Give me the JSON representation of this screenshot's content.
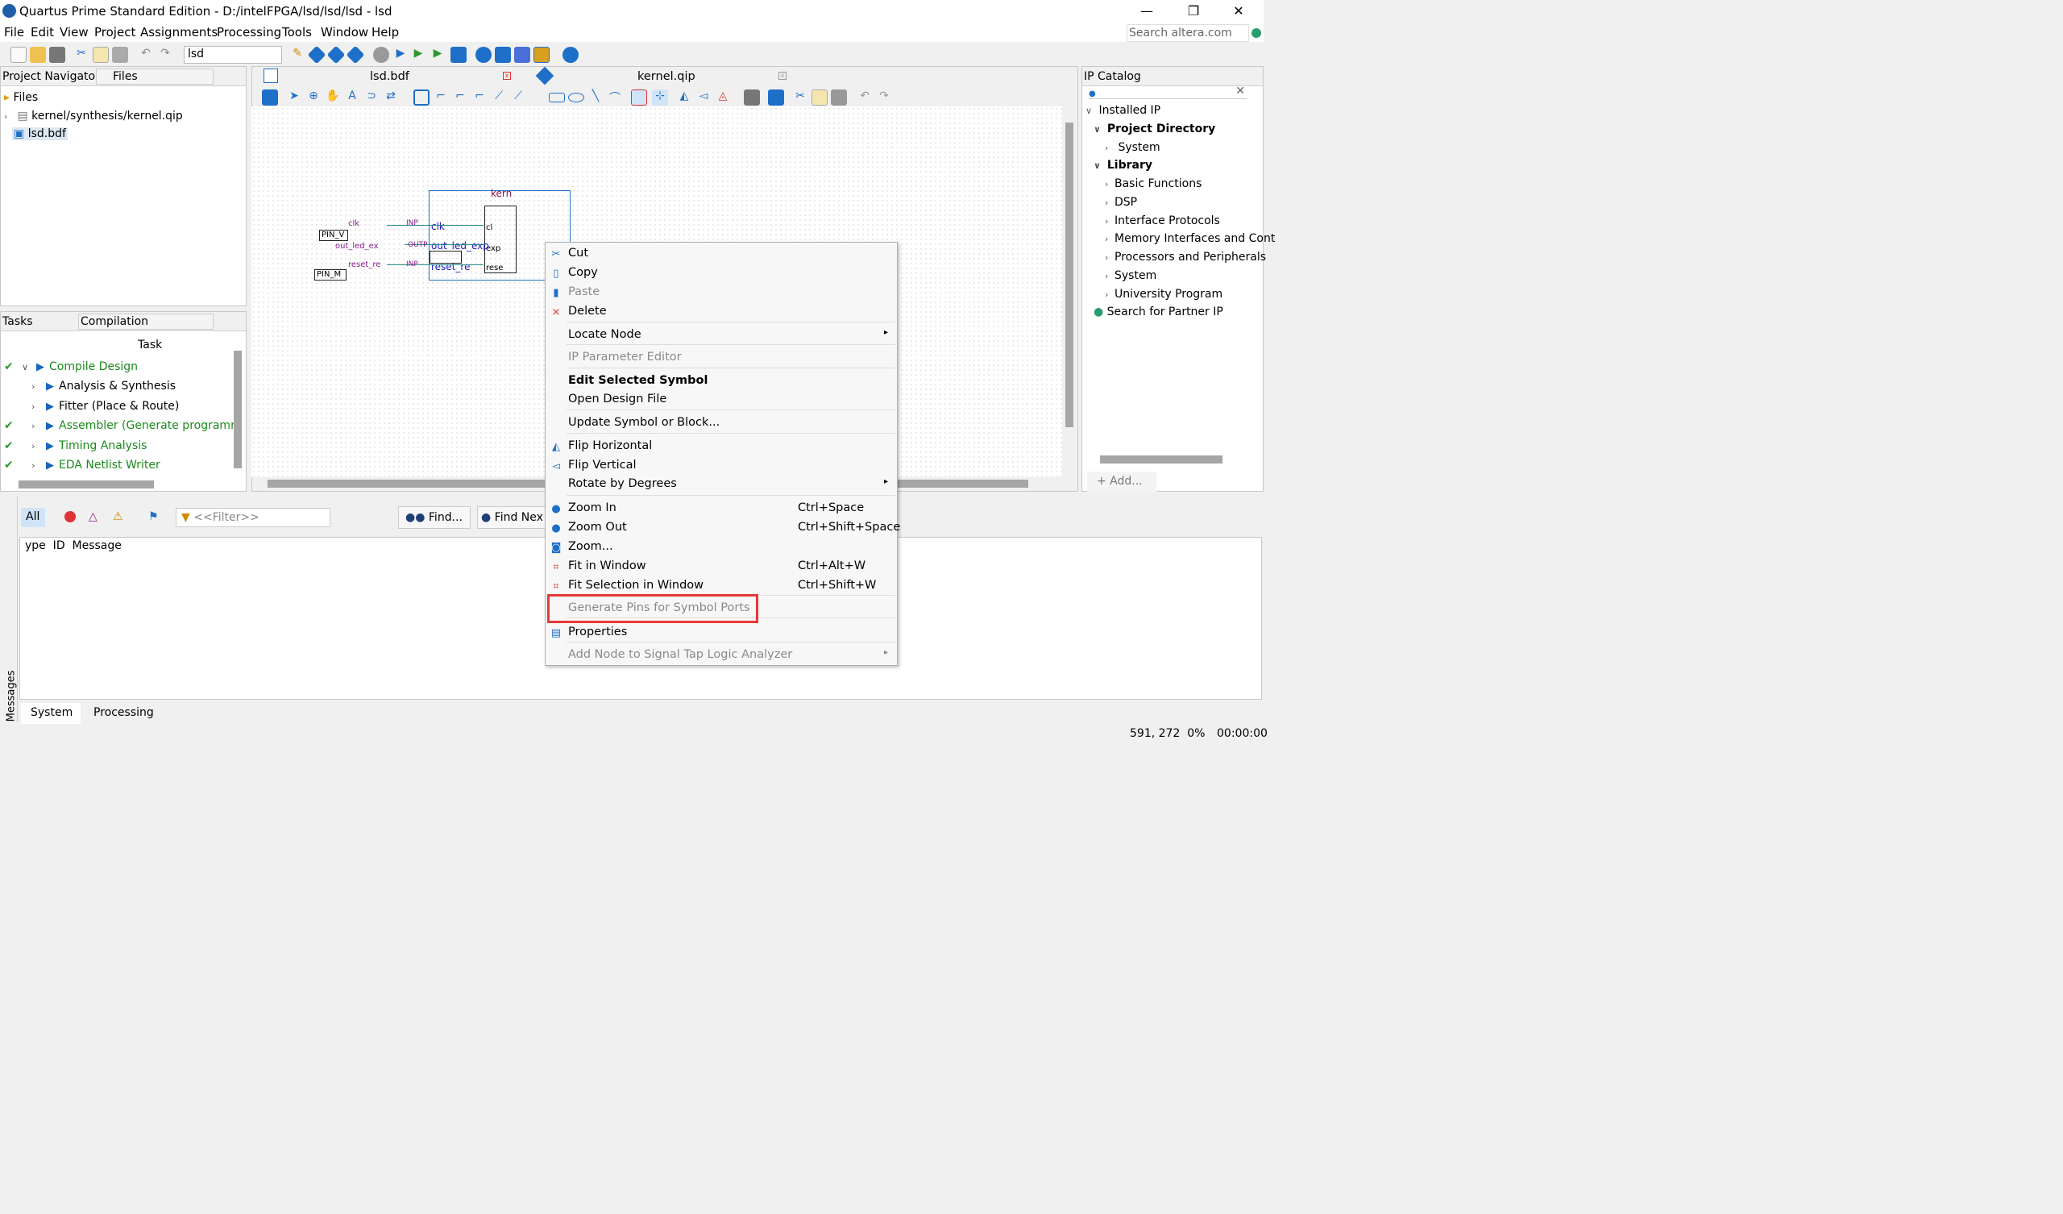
{
  "window": {
    "title": "Quartus Prime Standard Edition - D:/intelFPGA/lsd/lsd/lsd - lsd",
    "minimize": "—",
    "maximize": "❐",
    "close": "✕"
  },
  "menubar": {
    "items": [
      "File",
      "Edit",
      "View",
      "Project",
      "Assignments",
      "Processing",
      "Tools",
      "Window",
      "Help"
    ],
    "search_placeholder": "Search altera.com"
  },
  "toolbar": {
    "revision": "lsd"
  },
  "project_navigator": {
    "title": "Project Navigator",
    "view": "Files",
    "root": "Files",
    "items": [
      "kernel/synthesis/kernel.qip",
      "lsd.bdf"
    ]
  },
  "tasks": {
    "title": "Tasks",
    "flow": "Compilation",
    "column": "Task",
    "rows": [
      {
        "label": "Compile Design",
        "done": true
      },
      {
        "label": "Analysis & Synthesis",
        "done": false
      },
      {
        "label": "Fitter (Place & Route)",
        "done": false
      },
      {
        "label": "Assembler (Generate programm",
        "done": true
      },
      {
        "label": "Timing Analysis",
        "done": true
      },
      {
        "label": "EDA Netlist Writer",
        "done": true
      }
    ]
  },
  "editor_tabs": [
    {
      "label": "lsd.bdf",
      "active": true
    },
    {
      "label": "kernel.qip",
      "active": false
    }
  ],
  "schematic": {
    "block_title": "kern",
    "pins": [
      "PIN_V",
      "PIN_M"
    ],
    "signals": [
      "clk",
      "out_led_ex",
      "reset_re"
    ],
    "port_types": [
      "INP",
      "OUTP",
      "INP"
    ],
    "block_ports": [
      "clk",
      "out_led_exp",
      "reset_re"
    ],
    "inner_ports": [
      "cl",
      "exp",
      "rese"
    ]
  },
  "context_menu": {
    "items": [
      {
        "label": "Cut",
        "shortcut": "",
        "icon": "scissors-icon"
      },
      {
        "label": "Copy",
        "shortcut": "",
        "icon": "copy-icon"
      },
      {
        "label": "Paste",
        "shortcut": "",
        "icon": "paste-icon"
      },
      {
        "label": "Delete",
        "shortcut": "",
        "icon": "delete-icon"
      },
      {
        "label": "Locate Node",
        "shortcut": "",
        "icon": ""
      },
      {
        "label": "IP Parameter Editor",
        "shortcut": "",
        "icon": ""
      },
      {
        "label": "Edit Selected Symbol",
        "shortcut": "",
        "icon": ""
      },
      {
        "label": "Open Design File",
        "shortcut": "",
        "icon": ""
      },
      {
        "label": "Update Symbol or Block...",
        "shortcut": "",
        "icon": ""
      },
      {
        "label": "Flip Horizontal",
        "shortcut": "",
        "icon": "flip-horizontal-icon"
      },
      {
        "label": "Flip Vertical",
        "shortcut": "",
        "icon": "flip-vertical-icon"
      },
      {
        "label": "Rotate by Degrees",
        "shortcut": "",
        "icon": ""
      },
      {
        "label": "Zoom In",
        "shortcut": "Ctrl+Space",
        "icon": "zoom-in-icon"
      },
      {
        "label": "Zoom Out",
        "shortcut": "Ctrl+Shift+Space",
        "icon": "zoom-out-icon"
      },
      {
        "label": "Zoom...",
        "shortcut": "",
        "icon": "zoom-icon"
      },
      {
        "label": "Fit in Window",
        "shortcut": "Ctrl+Alt+W",
        "icon": "fit-window-icon"
      },
      {
        "label": "Fit Selection in Window",
        "shortcut": "Ctrl+Shift+W",
        "icon": "fit-selection-icon"
      },
      {
        "label": "Generate Pins for Symbol Ports",
        "shortcut": "",
        "icon": ""
      },
      {
        "label": "Properties",
        "shortcut": "",
        "icon": "properties-icon"
      },
      {
        "label": "Add Node to Signal Tap Logic Analyzer",
        "shortcut": "",
        "icon": ""
      }
    ]
  },
  "ip_catalog": {
    "title": "IP Catalog",
    "installed": "Installed IP",
    "project_directory": "Project Directory",
    "project_children": [
      "System"
    ],
    "library": "Library",
    "library_children": [
      "Basic Functions",
      "DSP",
      "Interface Protocols",
      "Memory Interfaces and Cont",
      "Processors and Peripherals",
      "System",
      "University Program"
    ],
    "partner": "Search for Partner IP",
    "add_button": "+ Add..."
  },
  "messages": {
    "side_label": "Messages",
    "filter_all": "All",
    "filter_placeholder": "<<Filter>>",
    "find": "Find...",
    "find_next": "Find Nex",
    "columns": "ype  ID  Message",
    "tabs": [
      "System",
      "Processing"
    ]
  },
  "status": {
    "coords": "591, 272  0%",
    "time": "00:00:00"
  }
}
